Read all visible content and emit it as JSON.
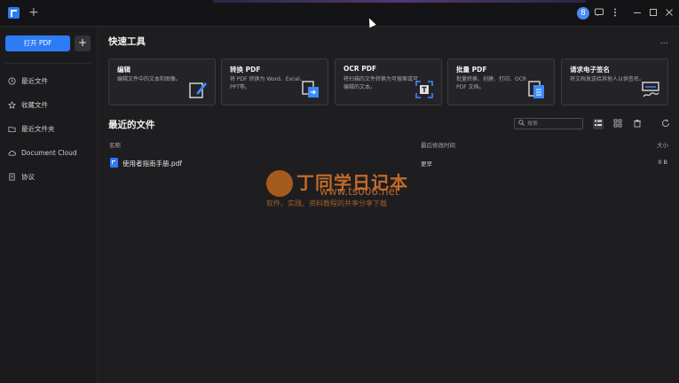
{
  "titlebar": {
    "new_tab": "+",
    "avatar_letter": "8",
    "icons": [
      "chat-icon",
      "more-vertical-icon",
      "minimize-icon",
      "maximize-icon",
      "close-icon"
    ]
  },
  "sidebar": {
    "open_pdf_label": "打开 PDF",
    "add_label": "+",
    "items": [
      {
        "label": "最近文件",
        "icon": "clock-icon"
      },
      {
        "label": "收藏文件",
        "icon": "star-icon"
      },
      {
        "label": "最近文件夹",
        "icon": "folder-icon"
      },
      {
        "label": "Document Cloud",
        "icon": "cloud-icon"
      },
      {
        "label": "协议",
        "icon": "document-icon"
      }
    ]
  },
  "quick_tools": {
    "title": "快速工具",
    "more": "...",
    "cards": [
      {
        "title": "编辑",
        "desc": "编辑文件中的文本和图像。",
        "icon": "edit-icon"
      },
      {
        "title": "转换 PDF",
        "desc": "将 PDF 转换为 Word、Excel、PPT等。",
        "icon": "convert-icon"
      },
      {
        "title": "OCR PDF",
        "desc": "将扫描的文件转换为可搜索或可编辑的文本。",
        "icon": "ocr-icon"
      },
      {
        "title": "批量 PDF",
        "desc": "批量转换、创建、打印、OCR PDF 文档。",
        "icon": "batch-icon"
      },
      {
        "title": "请求电子签名",
        "desc": "将文档发送给其他人以供签名。",
        "icon": "signature-icon"
      }
    ]
  },
  "recent": {
    "title": "最近的文件",
    "search_placeholder": "搜索",
    "columns": {
      "name": "名称",
      "modified": "最后修改时间",
      "size": "大小"
    },
    "files": [
      {
        "name": "使用者指南手册.pdf",
        "modified": "更早",
        "size": "0 B"
      }
    ]
  },
  "watermark": {
    "title": "丁同学日记本",
    "url": "www.ts006.net",
    "subtitle": "软件、实践、资料教程的共享分享下载"
  },
  "colors": {
    "accent": "#2e7bf6",
    "background": "#1e1e21",
    "sidebar": "#1b1b1e"
  }
}
